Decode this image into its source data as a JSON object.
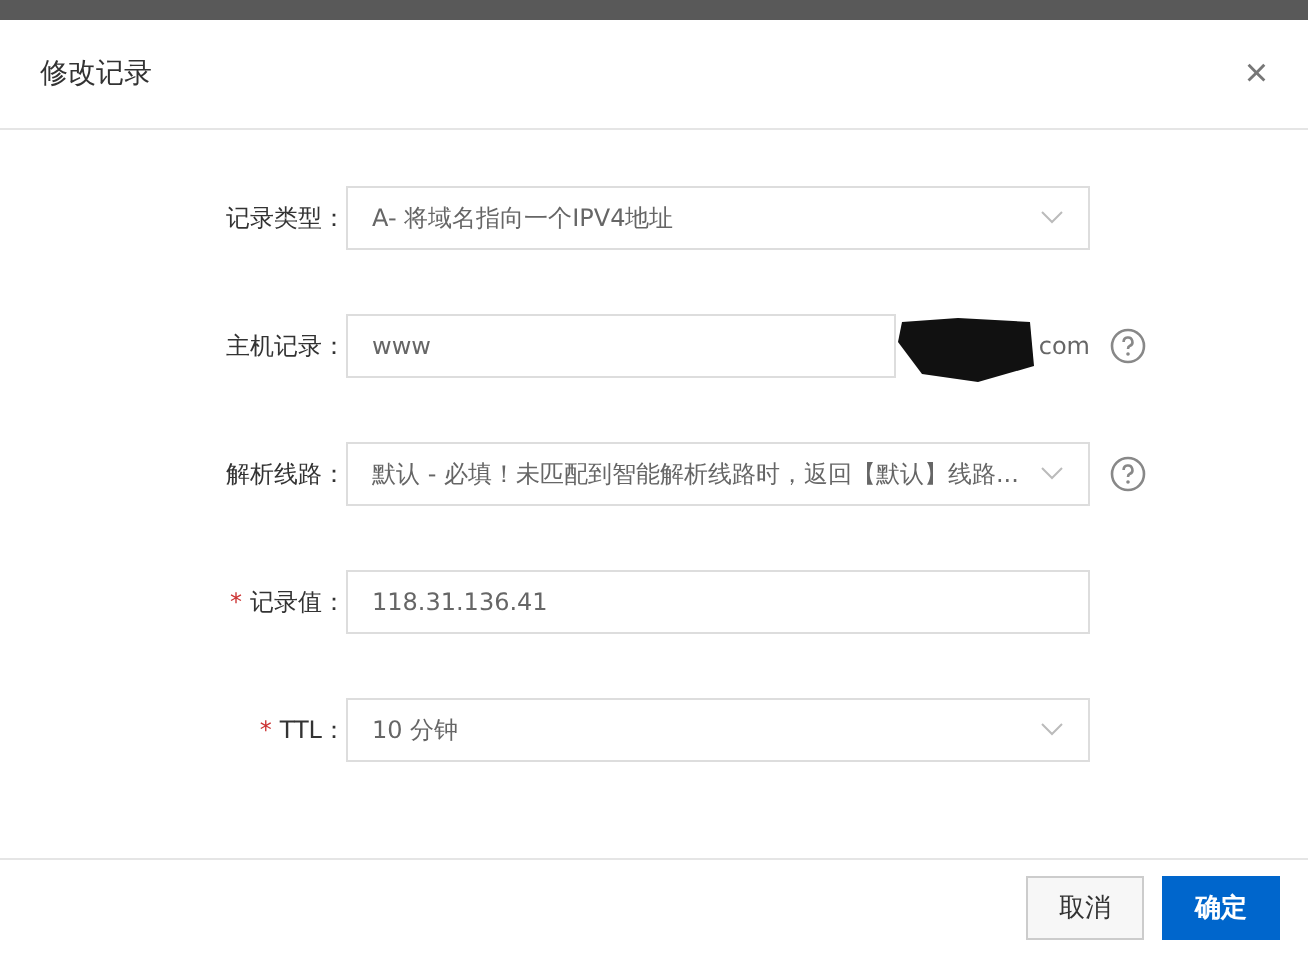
{
  "dialog": {
    "title": "修改记录",
    "close": "×"
  },
  "fields": [
    {
      "kind": "select",
      "label": "记录类型：",
      "value": "A- 将域名指向一个IPV4地址",
      "help": false
    },
    {
      "kind": "suffix-input",
      "label": "主机记录：",
      "value": "www",
      "suffix": "com",
      "help": true
    },
    {
      "kind": "select",
      "label": "解析线路：",
      "value": "默认 - 必填！未匹配到智能解析线路时，返回【默认】线路...",
      "help": true
    },
    {
      "kind": "input",
      "label": "记录值：",
      "required_mark": "*",
      "value": "118.31.136.41",
      "help": false
    },
    {
      "kind": "select",
      "label": "TTL：",
      "required_mark": "*",
      "value": "10 分钟",
      "help": false
    }
  ],
  "buttons": [
    {
      "label": "取消",
      "primary": false
    },
    {
      "label": "确定",
      "primary": true
    }
  ]
}
